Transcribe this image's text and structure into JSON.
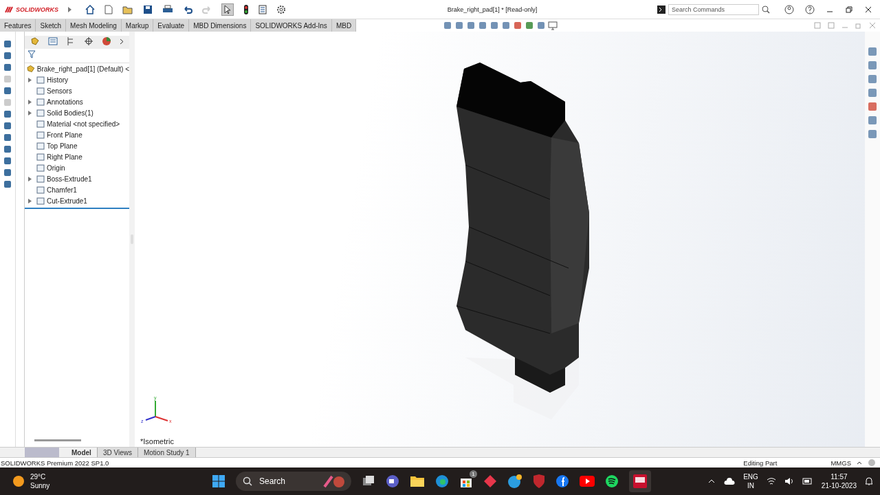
{
  "app": {
    "logo_text": "SOLIDWORKS"
  },
  "window": {
    "title": "Brake_right_pad[1] * [Read-only]"
  },
  "search": {
    "placeholder": "Search Commands"
  },
  "command_tabs": [
    {
      "label": "Features",
      "selected": false
    },
    {
      "label": "Sketch",
      "selected": false
    },
    {
      "label": "Mesh Modeling",
      "selected": false
    },
    {
      "label": "Markup",
      "selected": false
    },
    {
      "label": "Evaluate",
      "selected": false
    },
    {
      "label": "MBD Dimensions",
      "selected": false
    },
    {
      "label": "SOLIDWORKS Add-Ins",
      "selected": false
    },
    {
      "label": "MBD",
      "selected": false
    }
  ],
  "feature_tree": {
    "root": "Brake_right_pad[1] (Default) <",
    "items": [
      {
        "label": "History",
        "kind": "branch"
      },
      {
        "label": "Sensors",
        "kind": "leaf"
      },
      {
        "label": "Annotations",
        "kind": "branch"
      },
      {
        "label": "Solid Bodies(1)",
        "kind": "branch"
      },
      {
        "label": "Material <not specified>",
        "kind": "leaf"
      },
      {
        "label": "Front Plane",
        "kind": "leaf"
      },
      {
        "label": "Top Plane",
        "kind": "leaf"
      },
      {
        "label": "Right Plane",
        "kind": "leaf"
      },
      {
        "label": "Origin",
        "kind": "leaf"
      },
      {
        "label": "Boss-Extrude1",
        "kind": "branch"
      },
      {
        "label": "Chamfer1",
        "kind": "leaf"
      },
      {
        "label": "Cut-Extrude1",
        "kind": "branch"
      }
    ]
  },
  "viewport": {
    "view_name": "*Isometric",
    "triad": {
      "x": "x",
      "y": "y",
      "z": "z"
    }
  },
  "bottom_tabs": [
    {
      "label": "Model",
      "selected": true
    },
    {
      "label": "3D Views",
      "selected": false
    },
    {
      "label": "Motion Study 1",
      "selected": false
    }
  ],
  "status_bar": {
    "product": "SOLIDWORKS Premium 2022 SP1.0",
    "mode": "Editing Part",
    "units": "MMGS"
  },
  "taskbar": {
    "temperature": "29°C",
    "weather": "Sunny",
    "search": "Search",
    "store_badge": "1",
    "language": "ENG",
    "region": "IN",
    "time": "11:57",
    "date": "21-10-2023"
  }
}
